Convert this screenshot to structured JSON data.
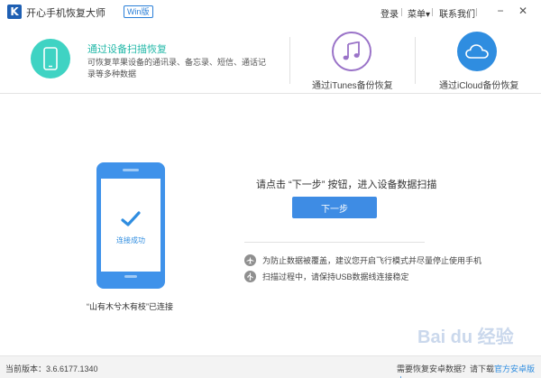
{
  "titlebar": {
    "logo_letter": "K",
    "app_title": "开心手机恢复大师",
    "badge": "Win版",
    "login": "登录",
    "menu": "菜单",
    "menu_arrow": "▾",
    "contact": "联系我们",
    "minimize": "−",
    "close": "✕"
  },
  "modes": {
    "device_scan": {
      "title": "通过设备扫描恢复",
      "description": "可恢复苹果设备的通讯录、备忘录、短信、通话记录等多种数据"
    },
    "itunes": {
      "label": "通过iTunes备份恢复"
    },
    "icloud": {
      "label": "通过iCloud备份恢复"
    }
  },
  "device": {
    "status": "连接成功",
    "label": "“山有木兮木有枝”已连接"
  },
  "main": {
    "instruction": "请点击 “下一步” 按钮，进入设备数据扫描",
    "next_button": "下一步",
    "tips": [
      "为防止数据被覆盖，建议您开启飞行模式并尽量停止使用手机",
      "扫描过程中，请保持USB数据线连接稳定"
    ]
  },
  "statusbar": {
    "version_label": "当前版本：3.6.6177.1340",
    "android_prompt": "需要恢复安卓数据？请下载",
    "android_link": "官方安卓版本"
  },
  "watermark": {
    "text": "Bai du 经验"
  },
  "colors": {
    "accent": "#2f8de0",
    "teal": "#3fd3c3",
    "purple": "#9a73c8",
    "button": "#3e8ce4"
  }
}
